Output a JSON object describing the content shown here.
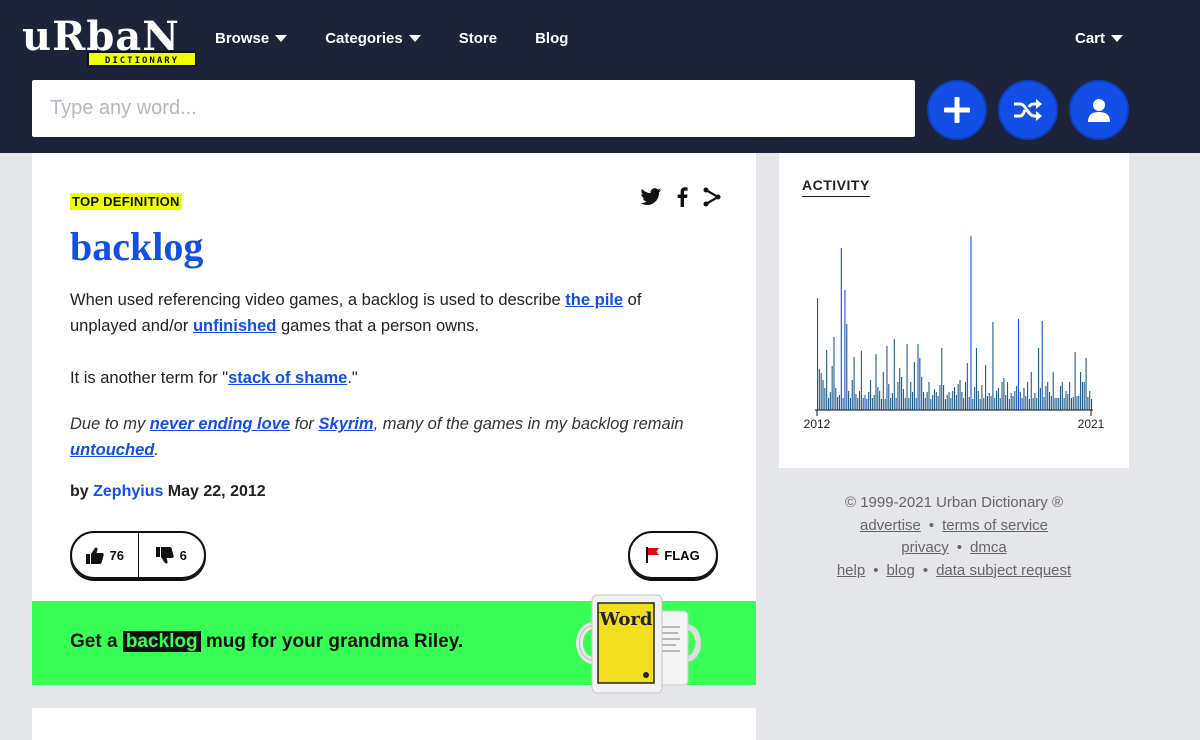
{
  "logo": {
    "word": "URBAN",
    "sub": "DICTIONARY"
  },
  "nav": {
    "browse": "Browse",
    "categories": "Categories",
    "store": "Store",
    "blog": "Blog",
    "cart": "Cart"
  },
  "search": {
    "placeholder": "Type any word..."
  },
  "colors": {
    "header": "#1d2439",
    "accent": "#134fe6",
    "highlight": "#efff00",
    "banner": "#38ff55"
  },
  "definition": {
    "badge": "TOP DEFINITION",
    "word": "backlog",
    "m1": "When used referencing video games, a backlog is used to describe ",
    "m1_link": "the pile",
    "m2": " of unplayed and/or ",
    "m2_link": "unfinished",
    "m3": " games that a person owns.",
    "m4": "It is another term for \"",
    "m4_link": "stack of shame",
    "m5": ".\"",
    "e1": "Due to my ",
    "e1_link": "never ending love",
    "e2": " for ",
    "e2_link": "Skyrim",
    "e3": ", many of the games in my backlog remain ",
    "e3_link": "untouched",
    "e4": ".",
    "by": "by ",
    "author": "Zephyius",
    "date": " May 22, 2012",
    "up_count": "76",
    "down_count": "6",
    "flag": "FLAG"
  },
  "mug": {
    "pre": "Get a ",
    "word": "backlog",
    "post": " mug for your grandma Riley.",
    "mug_label": "Word"
  },
  "activity": {
    "title": "ACTIVITY"
  },
  "chart_data": {
    "type": "bar",
    "xlabel_start": "2012",
    "xlabel_end": "2021",
    "xlim": [
      2012,
      2021
    ],
    "values": [
      112,
      41,
      37,
      30,
      22,
      60,
      12,
      18,
      44,
      73,
      22,
      13,
      15,
      162,
      12,
      120,
      86,
      19,
      12,
      30,
      53,
      16,
      12,
      19,
      59,
      12,
      15,
      11,
      18,
      30,
      12,
      15,
      56,
      23,
      19,
      11,
      38,
      11,
      64,
      26,
      12,
      17,
      71,
      12,
      28,
      42,
      33,
      21,
      12,
      66,
      12,
      28,
      18,
      48,
      12,
      66,
      52,
      33,
      18,
      12,
      18,
      28,
      11,
      15,
      21,
      18,
      14,
      25,
      62,
      25,
      11,
      15,
      18,
      12,
      19,
      23,
      15,
      26,
      30,
      18,
      12,
      28,
      47,
      13,
      174,
      11,
      23,
      62,
      19,
      11,
      25,
      12,
      45,
      14,
      17,
      14,
      88,
      12,
      19,
      22,
      12,
      28,
      32,
      15,
      28,
      11,
      17,
      14,
      19,
      24,
      91,
      18,
      12,
      22,
      14,
      28,
      11,
      38,
      12,
      17,
      12,
      62,
      22,
      89,
      13,
      24,
      28,
      18,
      14,
      38,
      12,
      12,
      12,
      24,
      28,
      12,
      19,
      16,
      28,
      12,
      13,
      58,
      14,
      14,
      38,
      28,
      28,
      52,
      13,
      19,
      11
    ],
    "highlights": [
      0,
      13,
      84,
      15,
      26,
      55,
      110,
      123
    ]
  },
  "footer": {
    "copyright": "© 1999-2021 Urban Dictionary ®",
    "advertise": "advertise",
    "terms": "terms of service",
    "privacy": "privacy",
    "dmca": "dmca",
    "help": "help",
    "blog": "blog",
    "dsr": "data subject request",
    "sep": "•"
  }
}
